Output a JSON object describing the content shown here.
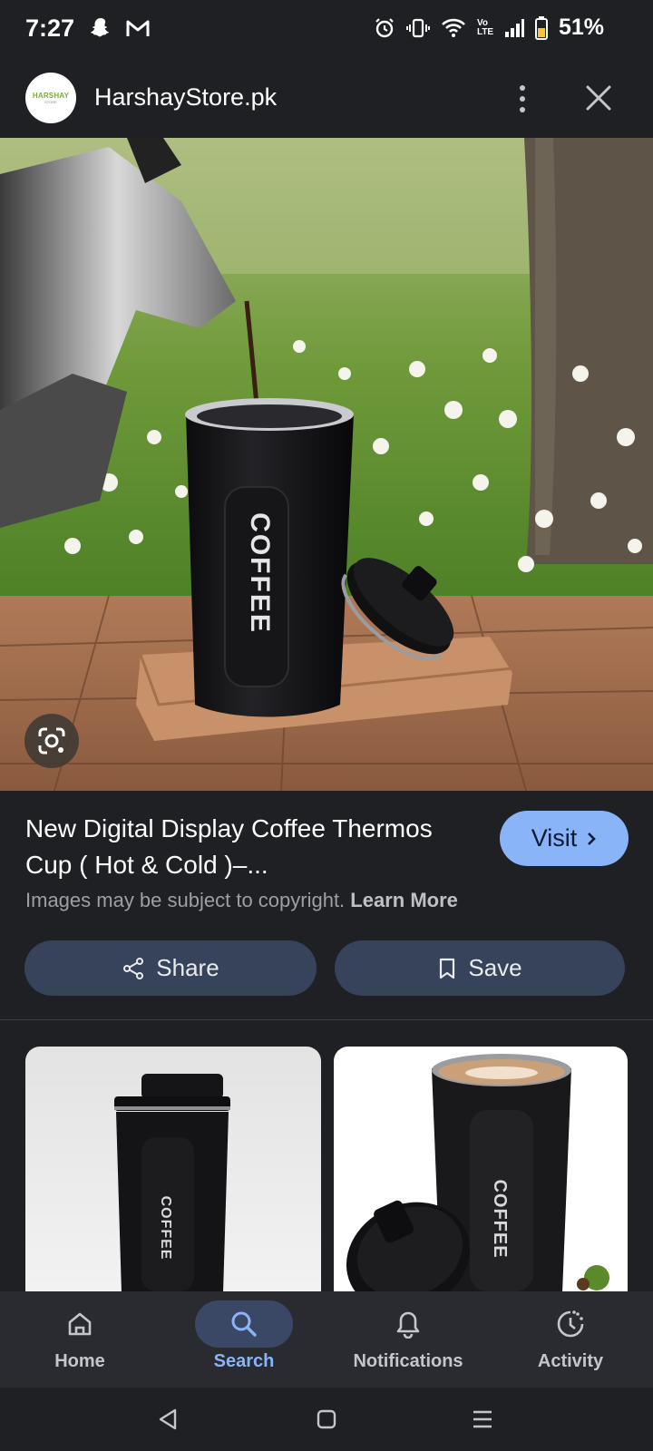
{
  "status_bar": {
    "time": "7:27",
    "battery": "51%",
    "network_label": "Vo LTE"
  },
  "header": {
    "logo_line1": "HARSHAY",
    "logo_line2": "STORE",
    "site_name": "HarshayStore.pk"
  },
  "product": {
    "title": "New Digital Display Coffee Thermos Cup ( Hot & Cold )–...",
    "visit_label": "Visit",
    "copyright_text": "Images may be subject to copyright.",
    "learn_more": "Learn More",
    "cup_text": "COFFEE"
  },
  "actions": {
    "share_label": "Share",
    "save_label": "Save"
  },
  "related": [
    {
      "cup_text": "COFFEE"
    },
    {
      "cup_text": "COFFEE"
    }
  ],
  "bottom_nav": {
    "items": [
      {
        "label": "Home",
        "icon": "home-icon"
      },
      {
        "label": "Search",
        "icon": "search-icon",
        "active": true
      },
      {
        "label": "Notifications",
        "icon": "bell-icon"
      },
      {
        "label": "Activity",
        "icon": "activity-icon"
      }
    ]
  },
  "colors": {
    "background": "#1f2024",
    "accent": "#8ab4f8",
    "button_bg": "#37435a",
    "nav_bg": "#2a2b30"
  }
}
